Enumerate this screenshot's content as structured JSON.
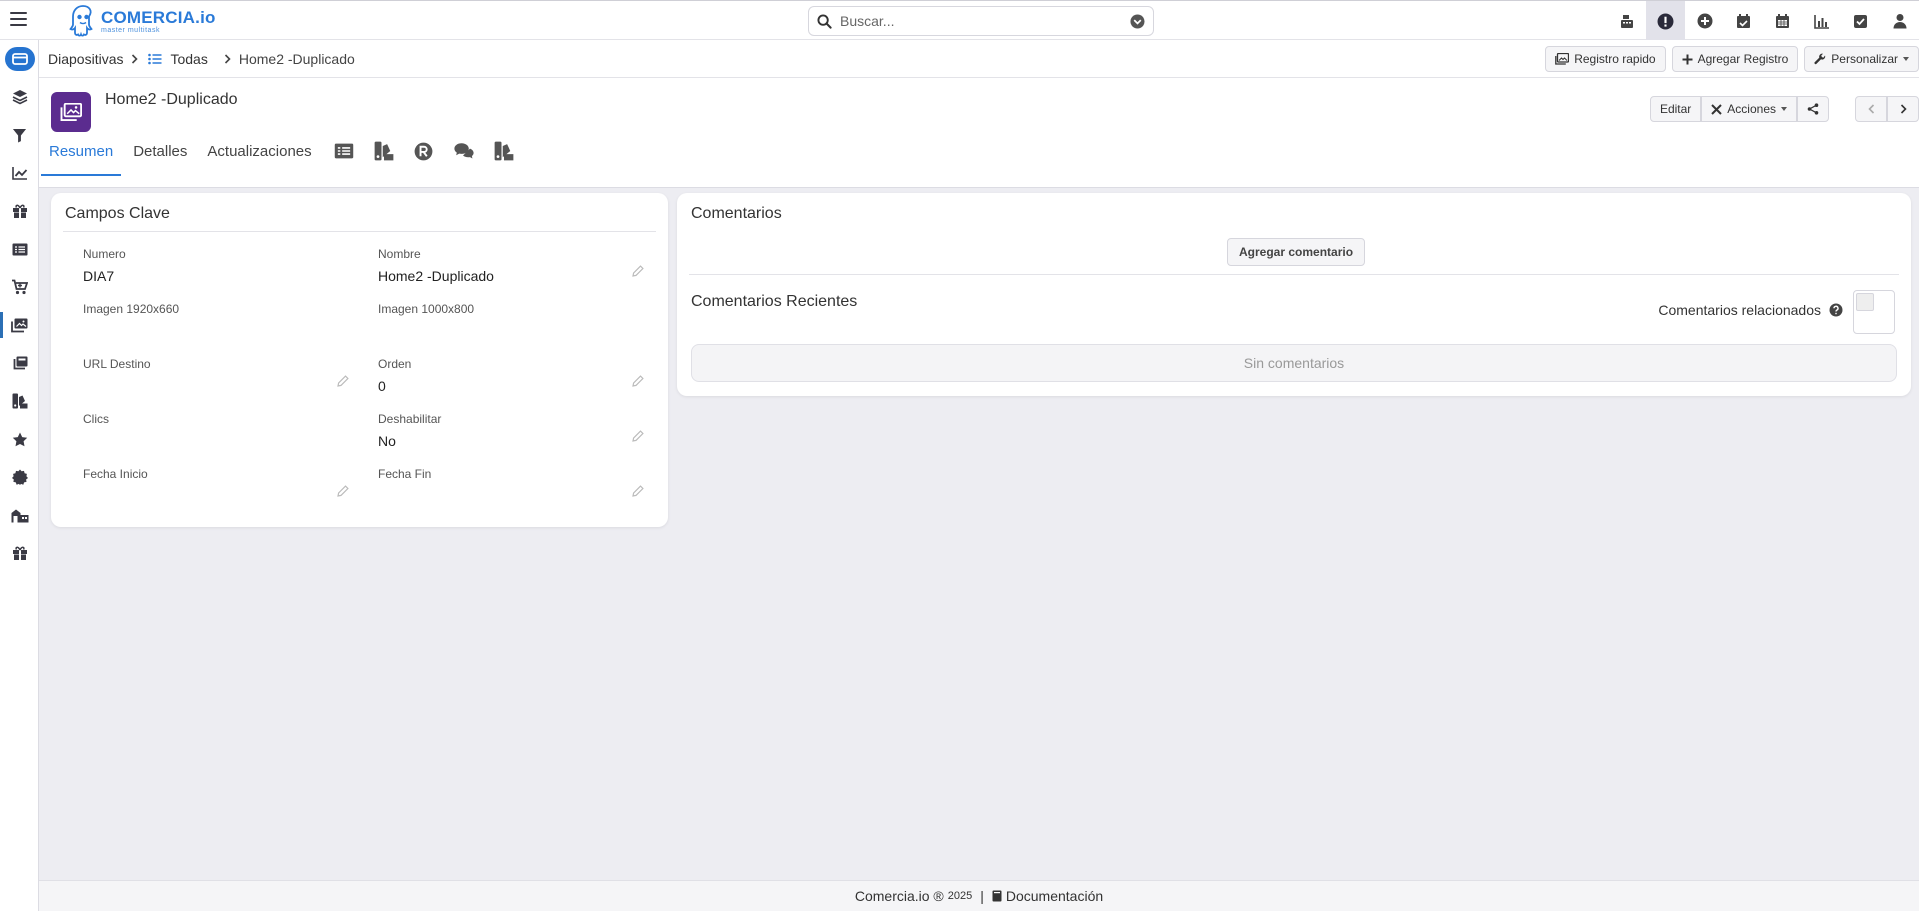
{
  "app": {
    "brand_name": "COMERCIA.io",
    "brand_tagline": "master multitask",
    "search_placeholder": "Buscar...",
    "accent": "#2a7ad8",
    "record_icon_color": "#5b2c8f"
  },
  "topbar": {
    "icons": [
      "cash-register-icon",
      "alert-circle-icon",
      "plus-circle-icon",
      "calendar-check-icon",
      "calendar-icon",
      "bar-chart-icon",
      "checkbox-icon",
      "user-icon"
    ]
  },
  "sidebar": {
    "items": [
      "home-icon",
      "layers-icon",
      "filter-icon",
      "chart-line-icon",
      "gift-icon",
      "list-icon",
      "cart-icon",
      "slides-icon",
      "copy-icon",
      "swatch-icon",
      "star-icon",
      "gear-icon",
      "warehouse-icon",
      "gift-alt-icon"
    ]
  },
  "breadcrumb": {
    "module": "Diapositivas",
    "list": "Todas",
    "record": "Home2 -Duplicado"
  },
  "actions": {
    "quick_record": "Registro rapido",
    "add_record": "Agregar Registro",
    "customize": "Personalizar"
  },
  "record": {
    "title": "Home2 -Duplicado",
    "edit": "Editar",
    "actions": "Acciones"
  },
  "tabs": {
    "summary": "Resumen",
    "details": "Detalles",
    "updates": "Actualizaciones"
  },
  "key_fields": {
    "title": "Campos Clave",
    "fields": [
      {
        "label": "Numero",
        "value": "DIA7"
      },
      {
        "label": "Nombre",
        "value": "Home2 -Duplicado"
      },
      {
        "label": "Imagen 1920x660",
        "value": ""
      },
      {
        "label": "Imagen 1000x800",
        "value": ""
      },
      {
        "label": "URL Destino",
        "value": ""
      },
      {
        "label": "Orden",
        "value": "0"
      },
      {
        "label": "Clics",
        "value": ""
      },
      {
        "label": "Deshabilitar",
        "value": "No"
      },
      {
        "label": "Fecha Inicio",
        "value": ""
      },
      {
        "label": "Fecha Fin",
        "value": ""
      }
    ]
  },
  "comments": {
    "title": "Comentarios",
    "add_button": "Agregar comentario",
    "recent_title": "Comentarios Recientes",
    "related_label": "Comentarios relacionados",
    "empty": "Sin comentarios"
  },
  "footer": {
    "brand": "Comercia.io ®",
    "year": "2025",
    "separator": "|",
    "docs": "Documentación"
  }
}
